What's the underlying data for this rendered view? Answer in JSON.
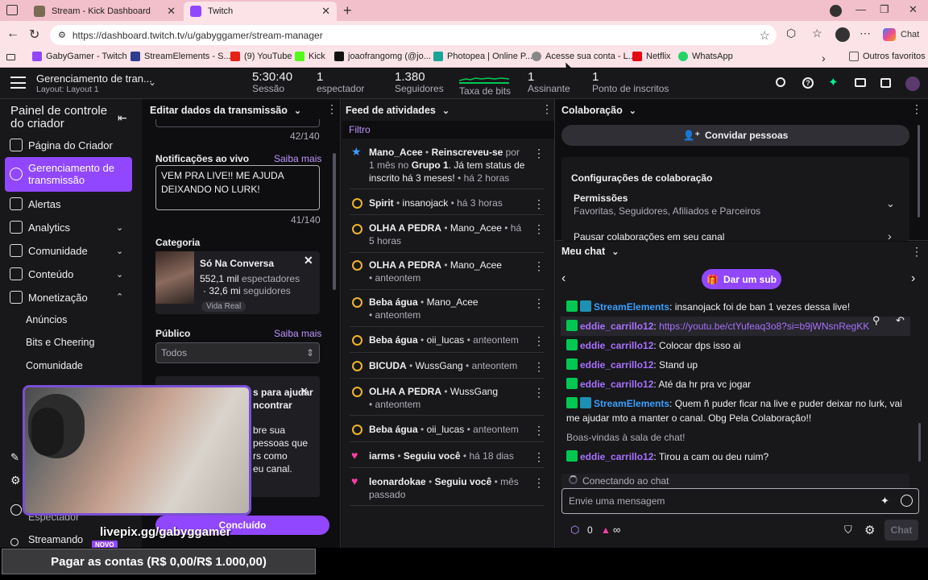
{
  "browser": {
    "tabs": [
      {
        "title": "Stream - Kick Dashboard"
      },
      {
        "title": "Twitch"
      }
    ],
    "url": "https://dashboard.twitch.tv/u/gabyggamer/stream-manager",
    "copilot": "Chat",
    "bookmarks": [
      "GabyGamer - Twitch",
      "StreamElements - S...",
      "(9) YouTube",
      "Kick",
      "joaofrangomg (@jo...",
      "Photopea | Online P...",
      "Acesse sua conta - L...",
      "Netflix",
      "WhatsApp"
    ],
    "other_favs": "Outros favoritos"
  },
  "top": {
    "title": "Gerenciamento de tran...",
    "layout": "Layout: Layout 1",
    "stats": [
      {
        "value": "5:30:40",
        "label": "Sessão"
      },
      {
        "value": "1",
        "label": "espectador"
      },
      {
        "value": "1.380",
        "label": "Seguidores"
      },
      {
        "value": "",
        "label": "Taxa de bits"
      },
      {
        "value": "1",
        "label": "Assinante"
      },
      {
        "value": "1",
        "label": "Ponto de inscritos"
      }
    ]
  },
  "sidebar": {
    "title": "Painel de controle do criador",
    "items": [
      "Página do Criador",
      "Gerenciamento de transmissão",
      "Alertas",
      "Analytics",
      "Comunidade",
      "Conteúdo",
      "Monetização"
    ],
    "sub": [
      "Anúncios",
      "Bits e Cheering",
      "Comunidade"
    ],
    "bottom": [
      "Espectador",
      "Streamando"
    ],
    "new_badge": "NOVO"
  },
  "edit": {
    "header": "Editar dados da transmissão",
    "title_count": "42/140",
    "notif_label": "Notificações ao vivo",
    "saiba": "Saiba mais",
    "notif_text": "VEM PRA LIVE!! ME AJUDA DEIXANDO NO LURK!",
    "notif_count": "41/140",
    "cat_label": "Categoria",
    "cat_name": "Só Na Conversa",
    "cat_viewers": "552,1 mil",
    "cat_viewers_suffix": "espectadores",
    "cat_followers": "32,6 mi",
    "cat_followers_suffix": "seguidores",
    "cat_tag": "Vida Real",
    "public_label": "Público",
    "public_value": "Todos",
    "promo_lines": [
      "s para ajudar",
      "ncontrar",
      "bre sua",
      "pessoas que",
      "rs como",
      "eu canal."
    ],
    "done": "Concluído"
  },
  "feed": {
    "header": "Feed de atividades",
    "filter": "Filtro",
    "items": [
      {
        "user": "Mano_Acee",
        "action": "Reinscreveu-se",
        "rest": " por 1 mês no ",
        "group": "Grupo 1",
        "tail": ". Já tem status de inscrito há 3 meses!",
        "time": "há 2 horas"
      },
      {
        "user": "Spirit",
        "by": "insanojack",
        "time": "há 3 horas"
      },
      {
        "user": "OLHA A PEDRA",
        "by": "Mano_Acee",
        "time": "há 5 horas"
      },
      {
        "user": "OLHA A PEDRA",
        "by": "Mano_Acee",
        "time": "anteontem"
      },
      {
        "user": "Beba água",
        "by": "Mano_Acee",
        "time": "anteontem"
      },
      {
        "user": "Beba água",
        "by": "oii_lucas",
        "time": "anteontem"
      },
      {
        "user": "BICUDA",
        "by": "WussGang",
        "time": "anteontem"
      },
      {
        "user": "OLHA A PEDRA",
        "by": "WussGang",
        "time": "anteontem"
      },
      {
        "user": "Beba água",
        "by": "oii_lucas",
        "time": "anteontem"
      },
      {
        "user": "iarms",
        "action": "Seguiu você",
        "time": "há 18 dias"
      },
      {
        "user": "leonardokae",
        "action": "Seguiu você",
        "time": "mês passado"
      }
    ]
  },
  "collab": {
    "header": "Colaboração",
    "invite": "Convidar pessoas",
    "settings": "Configurações de colaboração",
    "perm": "Permissões",
    "perm_sub": "Favoritas, Seguidores, Afiliados e Parceiros",
    "pause": "Pausar colaborações em seu canal"
  },
  "chat": {
    "header": "Meu chat",
    "give_sub": "Dar um sub",
    "lines": [
      {
        "user": "StreamElements",
        "text": ": insanojack foi de ban 1 vezes dessa live!",
        "se": true
      },
      {
        "user": "eddie_carrillo12",
        "text": ": ",
        "link": "https://youtu.be/ctYufeaq3o8?si=b9jWNsnRegKK"
      },
      {
        "user": "eddie_carrillo12",
        "text": ": Colocar dps isso ai"
      },
      {
        "user": "eddie_carrillo12",
        "text": ": Stand up"
      },
      {
        "user": "eddie_carrillo12",
        "text": ": Até da hr pra vc jogar"
      },
      {
        "user": "StreamElements",
        "text": ": Quem ñ puder ficar na live e puder deixar no lurk, vai",
        "se": true
      }
    ],
    "line_cont": "me ajudar mto a manter o canal. Obg Pela Colaboração!!",
    "welcome": "Boas-vindas à sala de chat!",
    "last": {
      "user": "eddie_carrillo12",
      "text": ": Tirou a cam ou deu ruim?"
    },
    "connecting": "Conectando ao chat",
    "placeholder": "Envie uma mensagem",
    "points": "0",
    "inf": "∞",
    "send": "Chat"
  },
  "overlay": {
    "site": "livepix.gg/gabyggamer",
    "bar": "Pagar as contas (R$ 0,00/R$ 1.000,00)"
  },
  "colors": {
    "accent": "#9147ff",
    "bg": "#0e0e10",
    "panel": "#18181b"
  }
}
